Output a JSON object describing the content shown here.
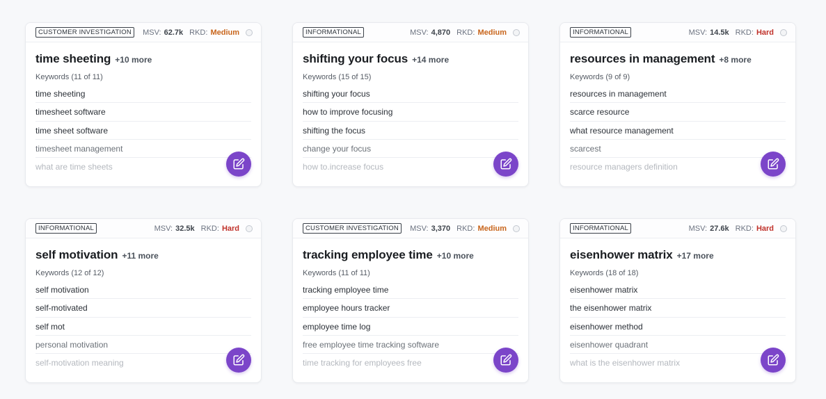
{
  "labels": {
    "msv": "MSV:",
    "rkd": "RKD:"
  },
  "colors": {
    "accent": "#7b45c9",
    "rkd_medium": "#c8651c",
    "rkd_hard": "#c0312a"
  },
  "cards": [
    {
      "intent": "CUSTOMER INVESTIGATION",
      "msv": "62.7k",
      "rkd": "Medium",
      "title": "time sheeting",
      "more": "+10 more",
      "keywords_label": "Keywords (11 of 11)",
      "keywords": [
        "time sheeting",
        "timesheet software",
        "time sheet software",
        "timesheet management",
        "what are time sheets"
      ]
    },
    {
      "intent": "INFORMATIONAL",
      "msv": "4,870",
      "rkd": "Medium",
      "title": "shifting your focus",
      "more": "+14 more",
      "keywords_label": "Keywords (15 of 15)",
      "keywords": [
        "shifting your focus",
        "how to improve focusing",
        "shifting the focus",
        "change your focus",
        "how to.increase focus"
      ]
    },
    {
      "intent": "INFORMATIONAL",
      "msv": "14.5k",
      "rkd": "Hard",
      "title": "resources in management",
      "more": "+8 more",
      "keywords_label": "Keywords (9 of 9)",
      "keywords": [
        "resources in management",
        "scarce resource",
        "what resource management",
        "scarcest",
        "resource managers definition"
      ]
    },
    {
      "intent": "INFORMATIONAL",
      "msv": "32.5k",
      "rkd": "Hard",
      "title": "self motivation",
      "more": "+11 more",
      "keywords_label": "Keywords (12 of 12)",
      "keywords": [
        "self motivation",
        "self-motivated",
        "self mot",
        "personal motivation",
        "self-motivation meaning"
      ]
    },
    {
      "intent": "CUSTOMER INVESTIGATION",
      "msv": "3,370",
      "rkd": "Medium",
      "title": "tracking employee time",
      "more": "+10 more",
      "keywords_label": "Keywords (11 of 11)",
      "keywords": [
        "tracking employee time",
        "employee hours tracker",
        "employee time log",
        "free employee time tracking software",
        "time tracking for employees free"
      ]
    },
    {
      "intent": "INFORMATIONAL",
      "msv": "27.6k",
      "rkd": "Hard",
      "title": "eisenhower matrix",
      "more": "+17 more",
      "keywords_label": "Keywords (18 of 18)",
      "keywords": [
        "eisenhower matrix",
        "the eisenhower matrix",
        "eisenhower method",
        "eisenhower quadrant",
        "what is the eisenhower matrix"
      ]
    }
  ]
}
